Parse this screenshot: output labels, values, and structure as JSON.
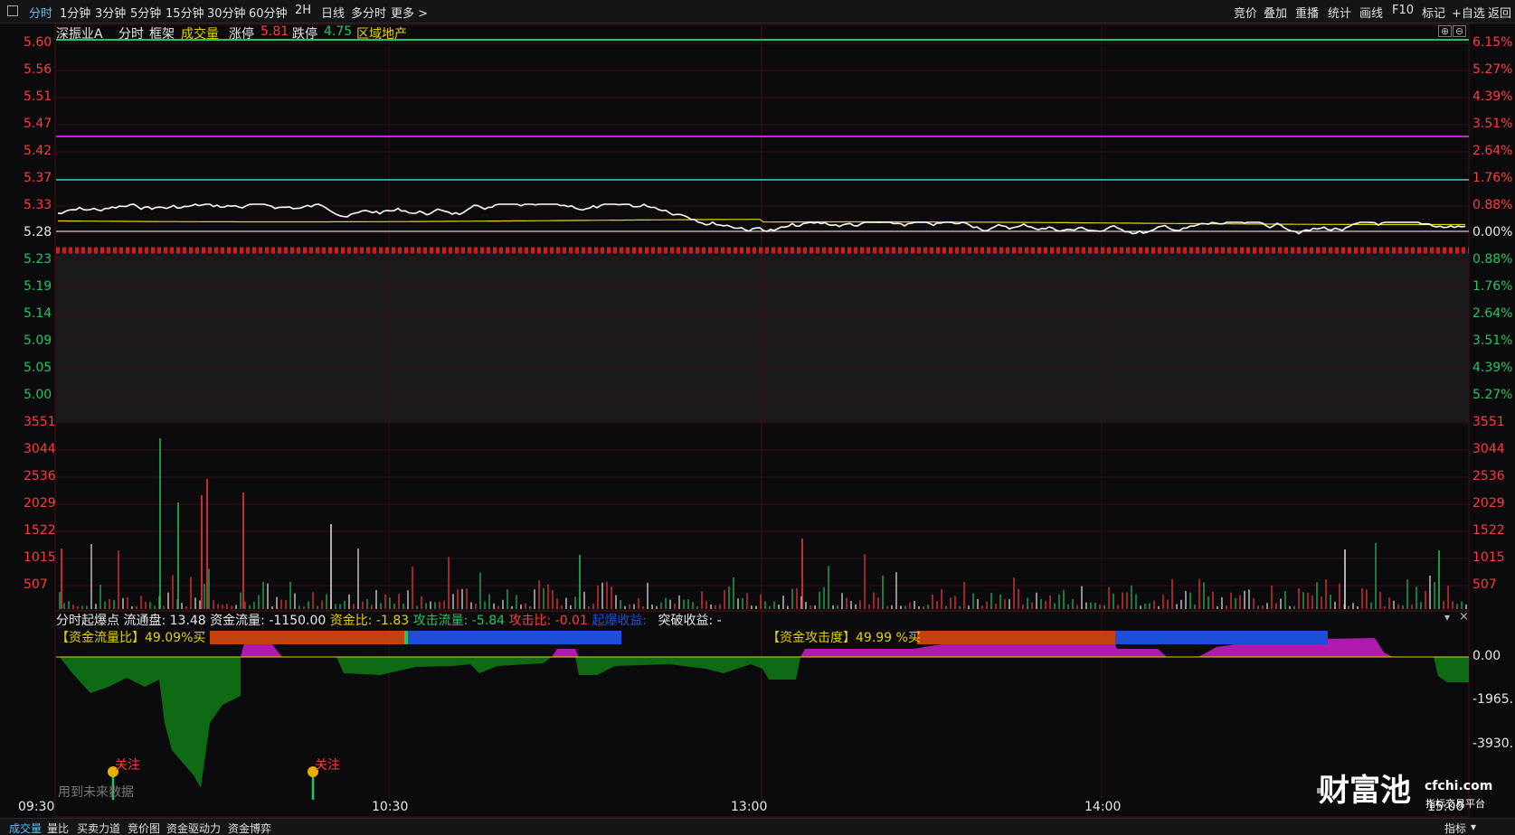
{
  "toolbar": {
    "periods": [
      "分时",
      "1分钟",
      "3分钟",
      "5分钟",
      "15分钟",
      "30分钟",
      "60分钟",
      "2H",
      "日线",
      "多分时",
      "更多 >"
    ],
    "right_buttons": [
      "竞价",
      "叠加",
      "重播",
      "统计",
      "画线",
      "F10",
      "标记",
      "+自选",
      "返回"
    ]
  },
  "header": {
    "stock": "深振业A",
    "mode": "分时",
    "frame": "框架",
    "volume_label": "成交量",
    "limit_up_label": "涨停",
    "limit_up": "5.81",
    "limit_down_label": "跌停",
    "limit_down": "4.75",
    "sector": "区域地产"
  },
  "price_axis": [
    "5.60",
    "5.56",
    "5.51",
    "5.47",
    "5.42",
    "5.37",
    "5.33",
    "5.28",
    "5.23",
    "5.19",
    "5.14",
    "5.09",
    "5.05",
    "5.00"
  ],
  "pct_axis": [
    "6.15%",
    "5.27%",
    "4.39%",
    "3.51%",
    "2.64%",
    "1.76%",
    "0.88%",
    "0.00%",
    "0.88%",
    "1.76%",
    "2.64%",
    "3.51%",
    "4.39%",
    "5.27%"
  ],
  "volume_axis": [
    "3551",
    "3044",
    "2536",
    "2029",
    "1522",
    "1015",
    "507"
  ],
  "indicator": {
    "title": "分时起爆点",
    "float_label": "流通盘:",
    "float_value": "13.48",
    "flow_label": "资金流量:",
    "flow_value": "-1150.00",
    "ratio_label": "资金比:",
    "ratio_value": "-1.83",
    "attack_label": "攻击流量:",
    "attack_value": "-5.84",
    "attack_ratio_label": "攻击比:",
    "attack_ratio_value": "-0.01",
    "burst_label": "起爆收益:",
    "break_label": "突破收益:",
    "break_value": "-",
    "flow_ratio_text": "【资金流量比】49.09%买",
    "attack_deg_text": "【资金攻击度】49.99 %买",
    "axis": [
      "0.00",
      "-1965.",
      "-3930."
    ],
    "mark_label": "关注",
    "future_note": "用到未来数据"
  },
  "time_axis": [
    "09:30",
    "10:30",
    "13:00",
    "14:00",
    "15:00"
  ],
  "watermark": {
    "brand": "财富池",
    "site": "cfchi.com",
    "slogan": "指标交易平台"
  },
  "bottom_tabs": [
    "成交量",
    "量比",
    "买卖力道",
    "竞价图",
    "资金驱动力",
    "资金博弈"
  ],
  "bottom_right": "指标",
  "colors": {
    "up": "#ff3b3b",
    "down": "#22c55e",
    "accent": "#4fc3ff",
    "yellow": "#e6d200",
    "magenta": "#c026d3",
    "cyan": "#38c8d8"
  }
}
